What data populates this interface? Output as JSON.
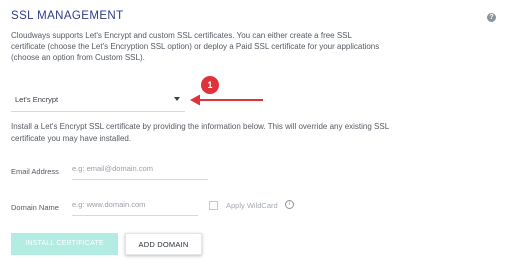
{
  "section": {
    "title": "SSL MANAGEMENT",
    "description": "Cloudways supports Let's Encrypt and custom SSL certificates. You can either create a free SSL certificate (choose the Let's Encryption SSL option) or deploy a Paid SSL certificate for your applications (choose an option from Custom SSL).",
    "help_icon": "?"
  },
  "ssl_type": {
    "selected": "Let's Encrypt",
    "icon": "caret-down-icon"
  },
  "annotation": {
    "step": "1",
    "color": "#e0323b"
  },
  "info_text": "Install a Let's Encrypt SSL certificate by providing the information below. This will override any existing SSL certificate you may have installed.",
  "form": {
    "email": {
      "label": "Email Address",
      "placeholder": "e.g: email@domain.com",
      "value": ""
    },
    "domain": {
      "label": "Domain Name",
      "placeholder": "e.g: www.domain.com",
      "value": ""
    },
    "wildcard": {
      "label": "Apply WildCard",
      "checked": false,
      "info_icon": "i"
    }
  },
  "buttons": {
    "install": "INSTALL CERTIFICATE",
    "add_domain": "ADD DOMAIN"
  },
  "colors": {
    "title": "#2e3a8c",
    "install_button_bg": "#b2ece3"
  }
}
